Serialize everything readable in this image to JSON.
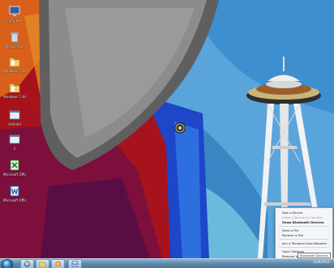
{
  "desktop": {
    "icons": [
      {
        "label": "Computer",
        "icon": "computer-icon"
      },
      {
        "label": "Recycle Bin",
        "icon": "recycle-bin-icon"
      },
      {
        "label": "Windows 7 drive 64-b",
        "icon": "folder-icon"
      },
      {
        "label": "Windows 7 drive 64-b",
        "icon": "folder-icon"
      },
      {
        "label": "Untitled",
        "icon": "window-icon"
      },
      {
        "label": "1",
        "icon": "window-icon"
      },
      {
        "label": "Microsoft Office Exc...",
        "icon": "excel-icon"
      },
      {
        "label": "Microsoft Office Wo...",
        "icon": "word-icon"
      }
    ]
  },
  "jumplist": {
    "items": [
      {
        "label": "Add a Device",
        "state": "normal"
      },
      {
        "label": "Allow a Device to Connect",
        "state": "disabled"
      },
      {
        "label": "Show Bluetooth Devices",
        "state": "bold"
      },
      {
        "label": "Send a File",
        "state": "normal"
      },
      {
        "label": "Receive a File",
        "state": "normal"
      },
      {
        "label": "Join a Personal Area Network",
        "state": "normal"
      },
      {
        "label": "Open Settings",
        "state": "normal"
      },
      {
        "label": "Remove Icon",
        "state": "normal"
      }
    ]
  },
  "tooltip": {
    "text": "Bluetooth Devices"
  },
  "taskbar": {
    "buttons": [
      {
        "icon": "internet-explorer-icon"
      },
      {
        "icon": "file-explorer-icon"
      },
      {
        "icon": "media-player-icon"
      },
      {
        "icon": "word-icon"
      }
    ],
    "clock": "5/26/2011"
  },
  "colors": {
    "sky": "#5fa6da",
    "taskbar": "#5b87ac",
    "menu_bg": "#f3f5f8"
  }
}
